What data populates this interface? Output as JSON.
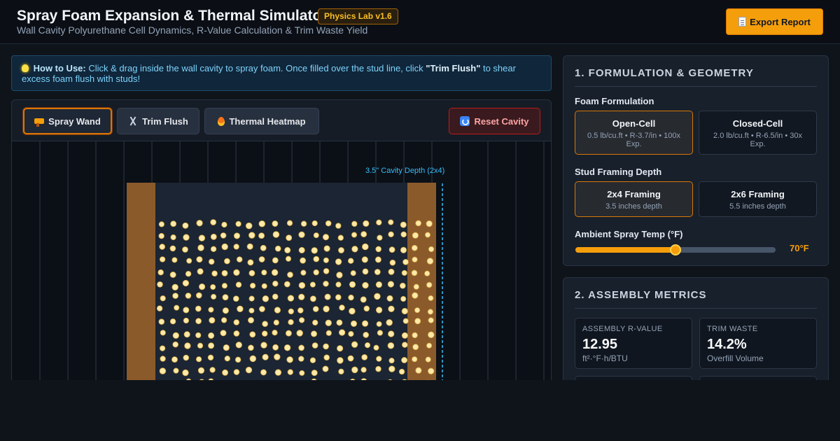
{
  "header": {
    "title": "Spray Foam Expansion & Thermal Simulator",
    "badge": "Physics Lab v1.6",
    "subtitle": "Wall Cavity Polyurethane Cell Dynamics, R-Value Calculation & Trim Waste Yield",
    "export_label": "Export Report",
    "export_icon": "document-icon"
  },
  "howto": {
    "lead": "How to Use:",
    "text_before": " Click & drag inside the wall cavity to spray foam. Once filled over the stud line, click ",
    "highlight": "\"Trim Flush\"",
    "text_after": " to shear excess foam flush with studs!",
    "icon": "lightbulb-icon"
  },
  "toolbar": {
    "spray_label": "Spray Wand",
    "trim_label": "Trim Flush",
    "heatmap_label": "Thermal Heatmap",
    "reset_label": "Reset Cavity",
    "active_tool": "Spray Wand"
  },
  "canvas": {
    "depth_label": "3.5\" Cavity Depth (2x4)",
    "colors": {
      "stud": "#8b5a2b",
      "cavity": "#1b2533",
      "foam_cell": "#fde9a8",
      "stud_line": "#38bdf8"
    }
  },
  "formulation": {
    "title": "1. FORMULATION & GEOMETRY",
    "foam_label": "Foam Formulation",
    "foam_options": [
      {
        "name": "Open-Cell",
        "desc": "0.5 lb/cu.ft • R-3.7/in • 100x Exp.",
        "selected": true
      },
      {
        "name": "Closed-Cell",
        "desc": "2.0 lb/cu.ft • R-6.5/in • 30x Exp.",
        "selected": false
      }
    ],
    "stud_label": "Stud Framing Depth",
    "stud_options": [
      {
        "name": "2x4 Framing",
        "desc": "3.5 inches depth",
        "selected": true
      },
      {
        "name": "2x6 Framing",
        "desc": "5.5 inches depth",
        "selected": false
      }
    ],
    "temp_label": "Ambient Spray Temp (°F)",
    "temp_value": "70°F",
    "temp_fraction": 0.5
  },
  "metrics": {
    "title": "2. ASSEMBLY METRICS",
    "items": [
      {
        "label": "ASSEMBLY R-VALUE",
        "value": "12.95",
        "unit": "ft²·°F·h/BTU"
      },
      {
        "label": "TRIM WASTE",
        "value": "14.2%",
        "unit": "Overfill Volume"
      }
    ]
  },
  "colors": {
    "accent": "#f59e0b",
    "background": "#0f141b",
    "panel": "#18202b",
    "info": "#7dd3fc",
    "danger": "#b91c1c"
  }
}
